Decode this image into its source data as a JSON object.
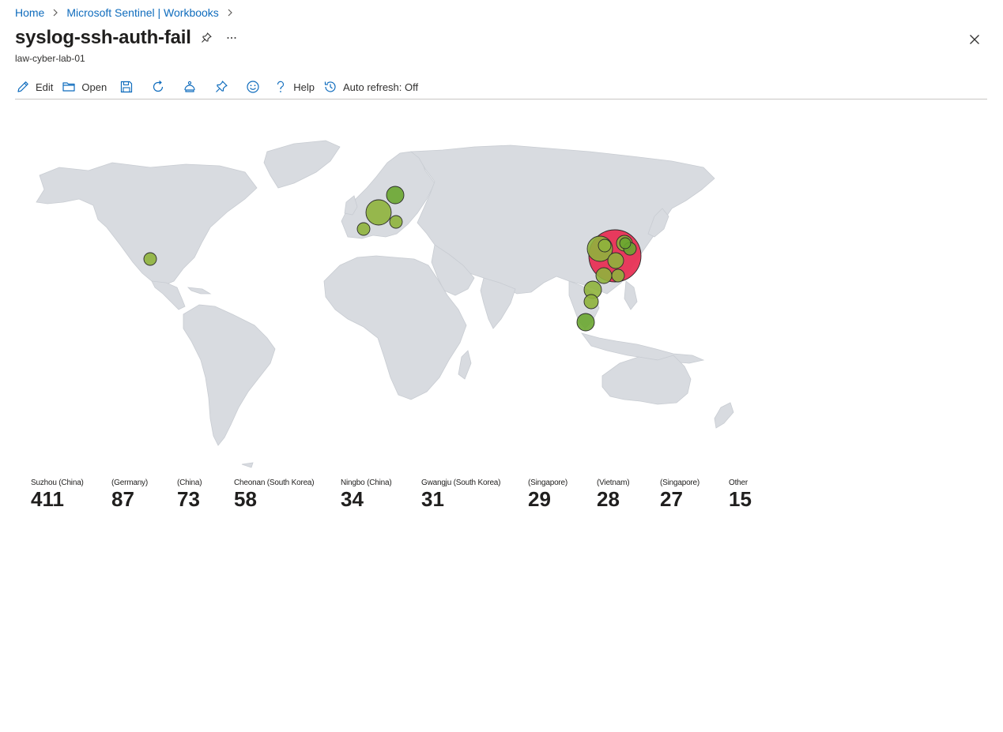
{
  "breadcrumb": {
    "home": "Home",
    "section": "Microsoft Sentinel | Workbooks"
  },
  "header": {
    "title": "syslog-ssh-auth-fail",
    "subtitle": "law-cyber-lab-01",
    "pin_icon": "pin-icon",
    "more_icon": "more-icon",
    "close_icon": "close-icon"
  },
  "toolbar": {
    "edit_label": "Edit",
    "open_label": "Open",
    "help_label": "Help",
    "auto_refresh_label": "Auto refresh: Off",
    "icons": [
      "edit-icon",
      "open-folder-icon",
      "save-icon",
      "refresh-icon",
      "share-icon",
      "pin-icon",
      "feedback-icon",
      "help-icon",
      "history-icon"
    ]
  },
  "map": {
    "accent_colors": {
      "land": "#d8dbe0",
      "bubble_green": "#8fb23c",
      "bubble_green_dark": "#6aa630",
      "bubble_red": "#e83255"
    }
  },
  "tiles": [
    {
      "label": "Suzhou (China)",
      "value": "411"
    },
    {
      "label": "(Germany)",
      "value": "87"
    },
    {
      "label": "(China)",
      "value": "73"
    },
    {
      "label": "Cheonan (South Korea)",
      "value": "58"
    },
    {
      "label": "Ningbo (China)",
      "value": "34"
    },
    {
      "label": "Gwangju (South Korea)",
      "value": "31"
    },
    {
      "label": "(Singapore)",
      "value": "29"
    },
    {
      "label": "(Vietnam)",
      "value": "28"
    },
    {
      "label": "(Singapore)",
      "value": "27"
    },
    {
      "label": "Other",
      "value": "15"
    }
  ]
}
